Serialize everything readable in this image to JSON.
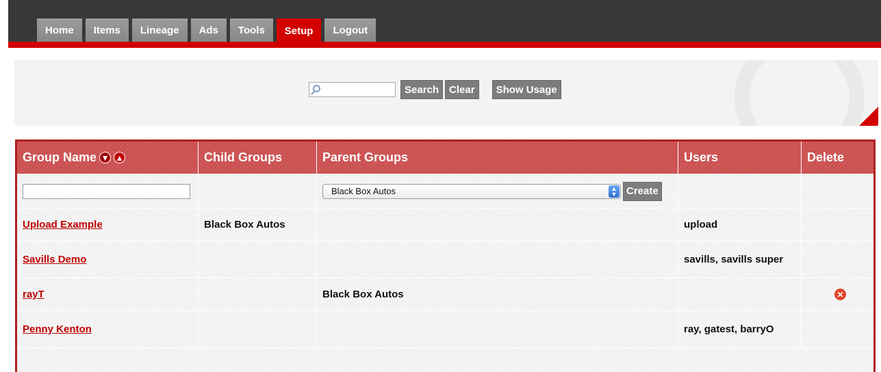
{
  "nav": {
    "tabs": [
      {
        "label": "Home"
      },
      {
        "label": "Items"
      },
      {
        "label": "Lineage"
      },
      {
        "label": "Ads"
      },
      {
        "label": "Tools"
      },
      {
        "label": "Setup",
        "active": true
      },
      {
        "label": "Logout"
      }
    ]
  },
  "search": {
    "value": "",
    "search_label": "Search",
    "clear_label": "Clear",
    "usage_label": "Show Usage"
  },
  "table": {
    "headers": {
      "group_name": "Group Name",
      "child_groups": "Child Groups",
      "parent_groups": "Parent Groups",
      "users": "Users",
      "delete": "Delete"
    },
    "filter": {
      "group_name_value": "",
      "parent_select_value": "Black Box Autos",
      "create_label": "Create"
    },
    "rows": [
      {
        "name": "Upload Example",
        "child": "Black Box Autos",
        "parent": "",
        "users": "upload"
      },
      {
        "name": "Savills Demo",
        "child": "",
        "parent": "",
        "users": "savills, savills super"
      },
      {
        "name": "rayT",
        "child": "",
        "parent": "Black Box Autos",
        "users": ""
      },
      {
        "name": "Penny Kenton",
        "child": "",
        "parent": "",
        "users": "ray, gatest, barryO"
      }
    ]
  },
  "colors": {
    "accent": "#d30000",
    "header_bg": "#d15a5a",
    "button_gray": "#7d7d7d"
  }
}
